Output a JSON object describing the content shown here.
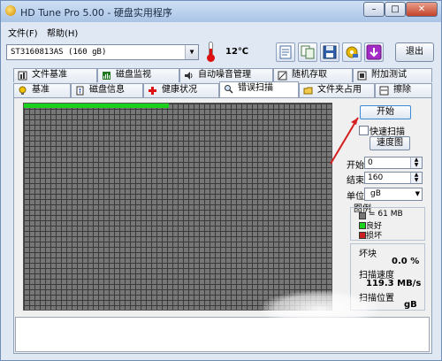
{
  "window": {
    "title": "HD Tune Pro 5.00 - 硬盘实用程序",
    "minimize_label": "–",
    "maximize_label": "□",
    "close_label": "✕"
  },
  "menu": {
    "file": "文件(F)",
    "help": "帮助(H)"
  },
  "toolbar": {
    "drive": "ST3160813AS (160 gB)",
    "temperature": "12℃",
    "exit_label": "退出",
    "icons": [
      "info-icon",
      "copy-icon",
      "save-icon",
      "options-icon",
      "download-icon"
    ]
  },
  "tabs": {
    "row1": [
      "文件基准",
      "磁盘监视",
      "自动噪音管理",
      "随机存取",
      "附加测试"
    ],
    "row2": [
      "基准",
      "磁盘信息",
      "健康状况",
      "错误扫描",
      "文件夹占用",
      "擦除"
    ],
    "active": "错误扫描"
  },
  "scan": {
    "start_button": "开始",
    "quick_scan_label": "快速扫描",
    "quick_scan_checked": false,
    "speed_map_button": "速度图",
    "start_label": "开始",
    "start_value": "0",
    "end_label": "结束",
    "end_value": "160",
    "unit_label": "单位",
    "unit_value": "gB",
    "legend_title": "图例",
    "legend_size": "= 61 MB",
    "legend_good": "良好",
    "legend_bad": "损坏",
    "damaged_label": "坏块",
    "damaged_value": "0.0 %",
    "speed_label": "扫描速度",
    "speed_value": "119.3 MB/s",
    "position_label": "扫描位置",
    "position_value": "gB",
    "good_color": "#1bd11b",
    "bad_color": "#cc1f1f",
    "unscanned_color": "#777777",
    "progress_fraction": 0.47
  }
}
